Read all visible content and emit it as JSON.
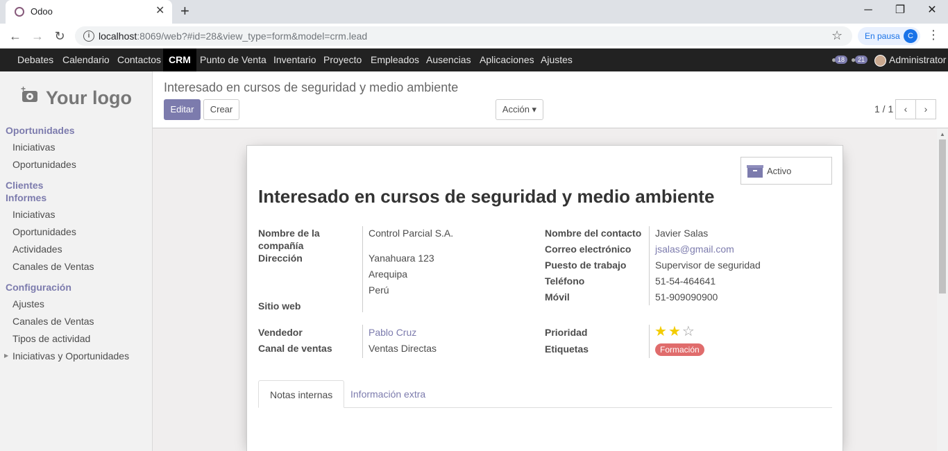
{
  "browser": {
    "tab_title": "Odoo",
    "url_host": "localhost",
    "url_rest": ":8069/web?#id=28&view_type=form&model=crm.lead",
    "profile_status": "En pausa",
    "profile_initial": "C"
  },
  "topnav": {
    "items": [
      "Debates",
      "Calendario",
      "Contactos",
      "CRM",
      "Punto de Venta",
      "Inventario",
      "Proyecto",
      "Empleados",
      "Ausencias",
      "Aplicaciones",
      "Ajustes"
    ],
    "active": "CRM",
    "activity_count": "18",
    "message_count": "21",
    "user": "Administrator"
  },
  "sidebar": {
    "logo_text": "Your logo",
    "sections": [
      {
        "title": "Oportunidades",
        "items": [
          "Iniciativas",
          "Oportunidades"
        ]
      },
      {
        "title": "Clientes",
        "items": []
      },
      {
        "title": "Informes",
        "items": [
          "Iniciativas",
          "Oportunidades",
          "Actividades",
          "Canales de Ventas"
        ]
      },
      {
        "title": "Configuración",
        "items": [
          "Ajustes",
          "Canales de Ventas",
          "Tipos de actividad",
          "Iniciativas y Oportunidades"
        ]
      }
    ]
  },
  "control_panel": {
    "breadcrumb": "Interesado en cursos de seguridad y medio ambiente",
    "edit_label": "Editar",
    "create_label": "Crear",
    "action_label": "Acción ▾",
    "pager": "1 / 1"
  },
  "form": {
    "archive_label": "Activo",
    "title": "Interesado en cursos de seguridad y medio ambiente",
    "labels": {
      "company_line1": "Nombre de la",
      "company_line2": "compañía",
      "address": "Dirección",
      "website": "Sitio web",
      "salesperson": "Vendedor",
      "sales_channel": "Canal de ventas",
      "contact_name": "Nombre del contacto",
      "email": "Correo electrónico",
      "job": "Puesto de trabajo",
      "phone": "Teléfono",
      "mobile": "Móvil",
      "priority": "Prioridad",
      "tags": "Etiquetas"
    },
    "values": {
      "company": "Control Parcial S.A.",
      "street": "Yanahuara 123",
      "city": "Arequipa",
      "country": "Perú",
      "salesperson": "Pablo Cruz",
      "sales_channel": "Ventas Directas",
      "contact_name": "Javier Salas",
      "email": "jsalas@gmail.com",
      "job": "Supervisor de seguridad",
      "phone": "51-54-464641",
      "mobile": "51-909090900",
      "priority_stars": 2,
      "priority_max": 3,
      "tag": "Formación"
    },
    "tabs": [
      "Notas internas",
      "Información extra"
    ]
  }
}
